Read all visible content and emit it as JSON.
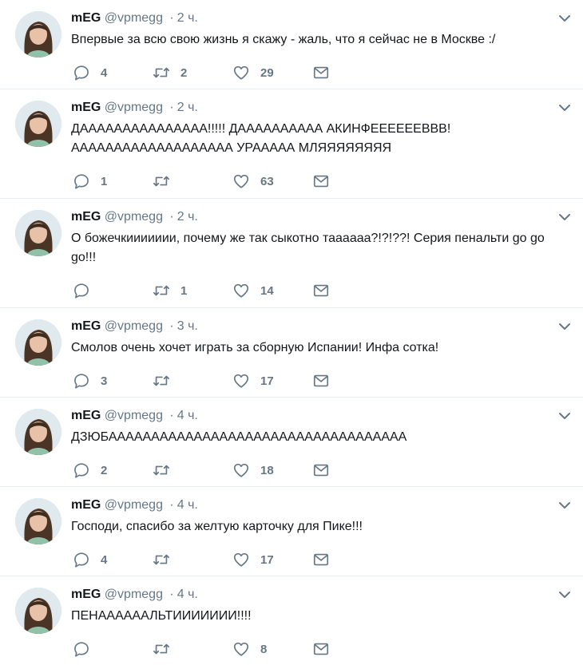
{
  "tweets": [
    {
      "name": "mEG",
      "handle": "@vpmegg",
      "separator": "·",
      "time": "2 ч.",
      "text": "Впервые за всю свою жизнь я скажу - жаль, что я сейчас не в Москве :/",
      "replies": "4",
      "retweets": "2",
      "likes": "29"
    },
    {
      "name": "mEG",
      "handle": "@vpmegg",
      "separator": "·",
      "time": "2 ч.",
      "text": "ДААААААААААААААА!!!!! ДАААААААААА АКИНФЕЕЕЕЕЕВВВ! ААААААААААААААААААА УРААААА МЛЯЯЯЯЯЯЯЯ",
      "replies": "1",
      "retweets": "",
      "likes": "63"
    },
    {
      "name": "mEG",
      "handle": "@vpmegg",
      "separator": "·",
      "time": "2 ч.",
      "text": "О божечкиииииии, почему же так сыкотно таааааа?!?!??! Серия пенальти go go go!!!",
      "replies": "",
      "retweets": "1",
      "likes": "14"
    },
    {
      "name": "mEG",
      "handle": "@vpmegg",
      "separator": "·",
      "time": "3 ч.",
      "text": "Смолов очень хочет играть за сборную Испании! Инфа сотка!",
      "replies": "3",
      "retweets": "",
      "likes": "17"
    },
    {
      "name": "mEG",
      "handle": "@vpmegg",
      "separator": "·",
      "time": "4 ч.",
      "text": "ДЗЮБААААААААААААААААААААААААААААААААААА",
      "replies": "2",
      "retweets": "",
      "likes": "18"
    },
    {
      "name": "mEG",
      "handle": "@vpmegg",
      "separator": "·",
      "time": "4 ч.",
      "text": "Господи, спасибо за желтую карточку для Пике!!!",
      "replies": "4",
      "retweets": "",
      "likes": "17"
    },
    {
      "name": "mEG",
      "handle": "@vpmegg",
      "separator": "·",
      "time": "4 ч.",
      "text": "ПЕНААААААЛЬТИИИИИИИ!!!!",
      "replies": "",
      "retweets": "",
      "likes": "8"
    }
  ],
  "icons": {
    "reply": "reply-icon",
    "retweet": "retweet-icon",
    "like": "heart-icon",
    "message": "envelope-icon",
    "more": "chevron-down-icon"
  },
  "colors": {
    "icon_gray": "#657786",
    "text": "#14171a",
    "divider": "#e6ecf0"
  }
}
